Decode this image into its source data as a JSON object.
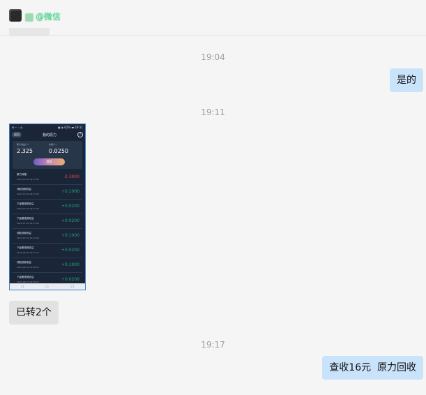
{
  "header": {
    "contact_name": "@微信",
    "avatar_icon": "avatar-icon"
  },
  "messages": [
    {
      "type": "time",
      "text": "19:04"
    },
    {
      "type": "text",
      "direction": "out",
      "text": "是的"
    },
    {
      "type": "time",
      "text": "19:11"
    },
    {
      "type": "image",
      "direction": "in"
    },
    {
      "type": "text",
      "direction": "in",
      "text": "已转2个"
    },
    {
      "type": "time",
      "text": "19:17"
    },
    {
      "type": "text",
      "direction": "out",
      "text": "查收16元  原力回收"
    }
  ],
  "phone": {
    "status_left": "⊞ ⌁ ◦ ◎",
    "status_right": "▣ ◈ 62% ▬ 19:11",
    "back_label": "返回",
    "title": "我的原力",
    "help_icon": "help-icon",
    "card": {
      "left_label": "累计收益(个)",
      "left_value": "2.325",
      "right_label": "余额(个)",
      "right_value": "0.0250",
      "button_label": "提现"
    },
    "rows": [
      {
        "title": "原力转赠",
        "date": "2022-07-02 19:11:08",
        "amount": "-2.3000",
        "sign": "neg"
      },
      {
        "title": "领取视频收益",
        "date": "2022-07-02 18:01:00",
        "amount": "+0.1000",
        "sign": "pos"
      },
      {
        "title": "下级看视频收益",
        "date": "2022-07-02 16:37:44",
        "amount": "+0.0200",
        "sign": "pos"
      },
      {
        "title": "下级看视频收益",
        "date": "2022-07-01 19:13:45",
        "amount": "+0.0200",
        "sign": "pos"
      },
      {
        "title": "领取视频收益",
        "date": "2022-07-01 15:23:44",
        "amount": "+0.1000",
        "sign": "pos"
      },
      {
        "title": "下级看视频收益",
        "date": "2022-06-30 19:07:27",
        "amount": "+0.0200",
        "sign": "pos"
      },
      {
        "title": "领取视频收益",
        "date": "2022-06-30 15:08:15",
        "amount": "+0.1000",
        "sign": "pos"
      },
      {
        "title": "下级看视频收益",
        "date": "2022-06-29 18:56:02",
        "amount": "+0.0200",
        "sign": "pos"
      }
    ],
    "nav": [
      "◁",
      "○",
      "□"
    ]
  }
}
